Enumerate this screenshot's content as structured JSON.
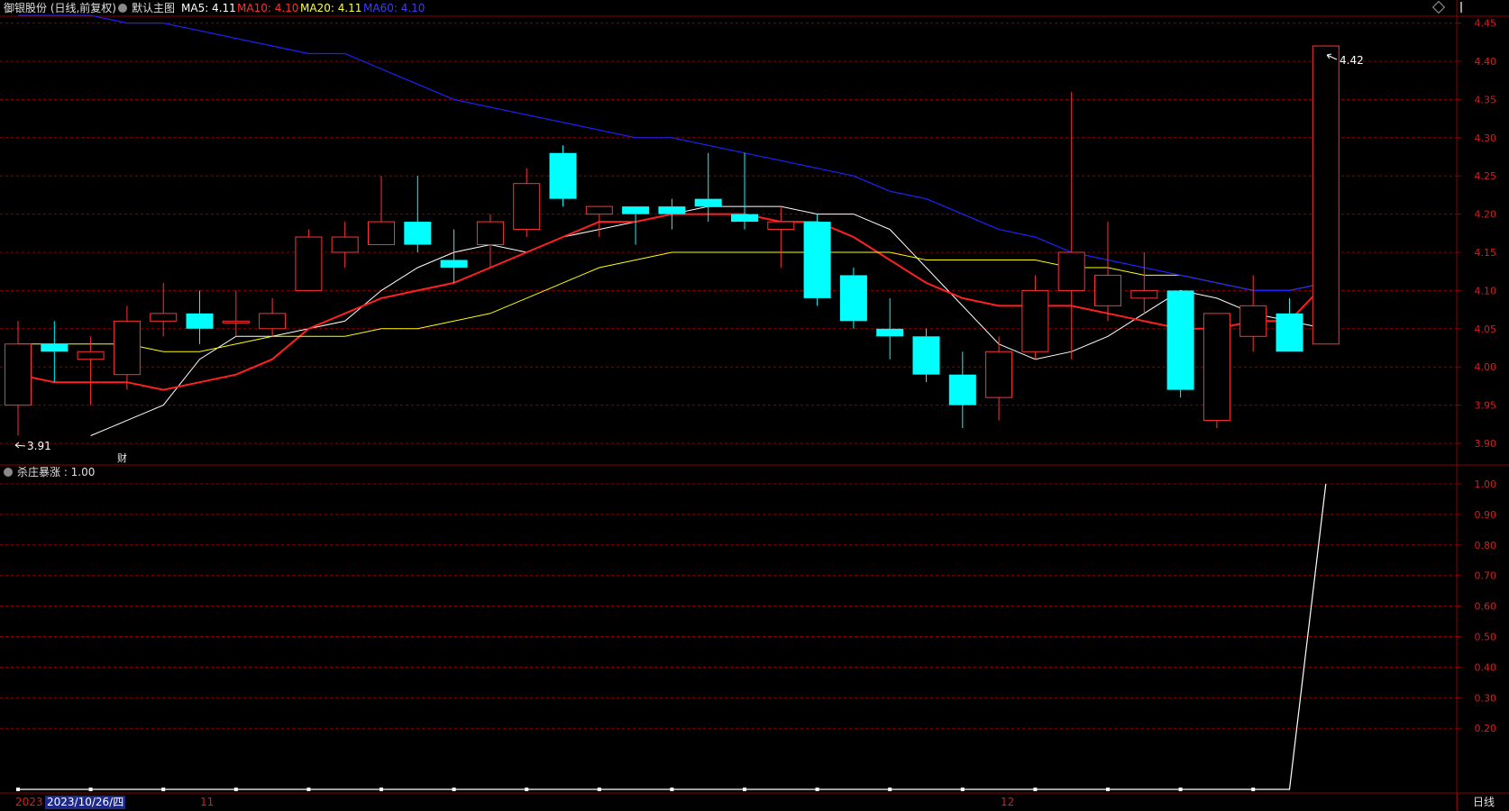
{
  "header": {
    "stock": "御银股份 (日线,前复权)",
    "template": "默认主图",
    "ma5": "MA5: 4.11",
    "ma10": "MA10: 4.10",
    "ma20": "MA20: 4.11",
    "ma60": "MA60: 4.10"
  },
  "indicator": {
    "title": "杀庄暴涨 : 1.00"
  },
  "annotations": {
    "low_label": "3.91",
    "high_label": "4.42",
    "finance_marker": "财"
  },
  "footer": {
    "year_prefix": "2023",
    "cursor_date": "2023/10/26/四",
    "month_11": "11",
    "month_12": "12",
    "period": "日线"
  },
  "colors": {
    "up": "#ff3232",
    "down": "#00ffff",
    "ma5": "#ffffff",
    "ma10": "#ff2020",
    "ma20": "#ffff00",
    "ma60": "#2020ff",
    "grid": "#8a0000"
  },
  "chart_data": [
    {
      "type": "candlestick",
      "title": "御银股份 (日线,前复权)",
      "ylim": [
        3.88,
        4.47
      ],
      "yticks": [
        "3.90",
        "3.95",
        "4.00",
        "4.05",
        "4.10",
        "4.15",
        "4.20",
        "4.25",
        "4.30",
        "4.35",
        "4.40",
        "4.45"
      ],
      "candles": [
        {
          "o": 3.95,
          "h": 4.06,
          "l": 3.91,
          "c": 4.03
        },
        {
          "o": 4.03,
          "h": 4.06,
          "l": 3.98,
          "c": 4.02
        },
        {
          "o": 4.01,
          "h": 4.04,
          "l": 3.95,
          "c": 4.02
        },
        {
          "o": 3.99,
          "h": 4.08,
          "l": 3.97,
          "c": 4.06
        },
        {
          "o": 4.06,
          "h": 4.11,
          "l": 4.04,
          "c": 4.07
        },
        {
          "o": 4.07,
          "h": 4.1,
          "l": 4.03,
          "c": 4.05
        },
        {
          "o": 4.06,
          "h": 4.1,
          "l": 4.04,
          "c": 4.06
        },
        {
          "o": 4.05,
          "h": 4.09,
          "l": 4.04,
          "c": 4.07
        },
        {
          "o": 4.1,
          "h": 4.18,
          "l": 4.1,
          "c": 4.17
        },
        {
          "o": 4.15,
          "h": 4.19,
          "l": 4.13,
          "c": 4.17
        },
        {
          "o": 4.16,
          "h": 4.25,
          "l": 4.16,
          "c": 4.19
        },
        {
          "o": 4.19,
          "h": 4.25,
          "l": 4.15,
          "c": 4.16
        },
        {
          "o": 4.14,
          "h": 4.18,
          "l": 4.11,
          "c": 4.13
        },
        {
          "o": 4.16,
          "h": 4.2,
          "l": 4.13,
          "c": 4.19
        },
        {
          "o": 4.18,
          "h": 4.26,
          "l": 4.17,
          "c": 4.24
        },
        {
          "o": 4.28,
          "h": 4.29,
          "l": 4.21,
          "c": 4.22
        },
        {
          "o": 4.2,
          "h": 4.21,
          "l": 4.17,
          "c": 4.21
        },
        {
          "o": 4.21,
          "h": 4.21,
          "l": 4.16,
          "c": 4.2
        },
        {
          "o": 4.21,
          "h": 4.22,
          "l": 4.18,
          "c": 4.2
        },
        {
          "o": 4.22,
          "h": 4.28,
          "l": 4.19,
          "c": 4.21
        },
        {
          "o": 4.2,
          "h": 4.28,
          "l": 4.18,
          "c": 4.19
        },
        {
          "o": 4.18,
          "h": 4.21,
          "l": 4.13,
          "c": 4.19
        },
        {
          "o": 4.19,
          "h": 4.2,
          "l": 4.08,
          "c": 4.09
        },
        {
          "o": 4.12,
          "h": 4.13,
          "l": 4.05,
          "c": 4.06
        },
        {
          "o": 4.05,
          "h": 4.09,
          "l": 4.01,
          "c": 4.04
        },
        {
          "o": 4.04,
          "h": 4.05,
          "l": 3.98,
          "c": 3.99
        },
        {
          "o": 3.99,
          "h": 4.02,
          "l": 3.92,
          "c": 3.95
        },
        {
          "o": 3.96,
          "h": 4.04,
          "l": 3.93,
          "c": 4.02
        },
        {
          "o": 4.02,
          "h": 4.12,
          "l": 4.01,
          "c": 4.1
        },
        {
          "o": 4.1,
          "h": 4.36,
          "l": 4.01,
          "c": 4.15
        },
        {
          "o": 4.08,
          "h": 4.19,
          "l": 4.06,
          "c": 4.12
        },
        {
          "o": 4.09,
          "h": 4.15,
          "l": 4.07,
          "c": 4.1
        },
        {
          "o": 4.1,
          "h": 4.1,
          "l": 3.96,
          "c": 3.97
        },
        {
          "o": 3.93,
          "h": 4.07,
          "l": 3.92,
          "c": 4.07
        },
        {
          "o": 4.04,
          "h": 4.12,
          "l": 4.02,
          "c": 4.08
        },
        {
          "o": 4.07,
          "h": 4.09,
          "l": 4.02,
          "c": 4.02
        },
        {
          "o": 4.03,
          "h": 4.42,
          "l": 4.03,
          "c": 4.42
        }
      ],
      "series": [
        {
          "name": "MA5",
          "values": [
            3.91,
            3.93,
            3.95,
            4.01,
            4.04,
            4.04,
            4.05,
            4.06,
            4.1,
            4.13,
            4.15,
            4.16,
            4.15,
            4.17,
            4.18,
            4.19,
            4.2,
            4.21,
            4.21,
            4.21,
            4.2,
            4.2,
            4.18,
            4.13,
            4.08,
            4.03,
            4.01,
            4.02,
            4.04,
            4.07,
            4.1,
            4.09,
            4.07,
            4.06,
            4.05
          ]
        },
        {
          "name": "MA10",
          "values": [
            3.99,
            3.98,
            3.98,
            3.98,
            3.97,
            3.98,
            3.99,
            4.01,
            4.05,
            4.07,
            4.09,
            4.1,
            4.11,
            4.13,
            4.15,
            4.17,
            4.19,
            4.19,
            4.2,
            4.2,
            4.2,
            4.19,
            4.19,
            4.17,
            4.14,
            4.11,
            4.09,
            4.08,
            4.08,
            4.08,
            4.07,
            4.06,
            4.05,
            4.05,
            4.06,
            4.06,
            4.11
          ]
        },
        {
          "name": "MA20",
          "values": [
            4.03,
            4.03,
            4.03,
            4.03,
            4.02,
            4.02,
            4.03,
            4.04,
            4.04,
            4.04,
            4.05,
            4.05,
            4.06,
            4.07,
            4.09,
            4.11,
            4.13,
            4.14,
            4.15,
            4.15,
            4.15,
            4.15,
            4.15,
            4.15,
            4.15,
            4.14,
            4.14,
            4.14,
            4.14,
            4.13,
            4.13,
            4.12,
            4.12,
            4.11,
            4.1,
            4.1,
            4.11
          ]
        },
        {
          "name": "MA60",
          "values": [
            4.46,
            4.46,
            4.46,
            4.45,
            4.45,
            4.44,
            4.43,
            4.42,
            4.41,
            4.41,
            4.39,
            4.37,
            4.35,
            4.34,
            4.33,
            4.32,
            4.31,
            4.3,
            4.3,
            4.29,
            4.28,
            4.27,
            4.26,
            4.25,
            4.23,
            4.22,
            4.2,
            4.18,
            4.17,
            4.15,
            4.14,
            4.13,
            4.12,
            4.11,
            4.1,
            4.1,
            4.11
          ]
        }
      ]
    },
    {
      "type": "line",
      "title": "杀庄暴涨 : 1.00",
      "ylim": [
        0,
        1.05
      ],
      "yticks": [
        "0.20",
        "0.30",
        "0.40",
        "0.50",
        "0.60",
        "0.70",
        "0.80",
        "0.90",
        "1.00"
      ],
      "series": [
        {
          "name": "杀庄暴涨",
          "values": [
            0,
            0,
            0,
            0,
            0,
            0,
            0,
            0,
            0,
            0,
            0,
            0,
            0,
            0,
            0,
            0,
            0,
            0,
            0,
            0,
            0,
            0,
            0,
            0,
            0,
            0,
            0,
            0,
            0,
            0,
            0,
            0,
            0,
            0,
            0,
            0,
            1
          ]
        }
      ]
    }
  ]
}
